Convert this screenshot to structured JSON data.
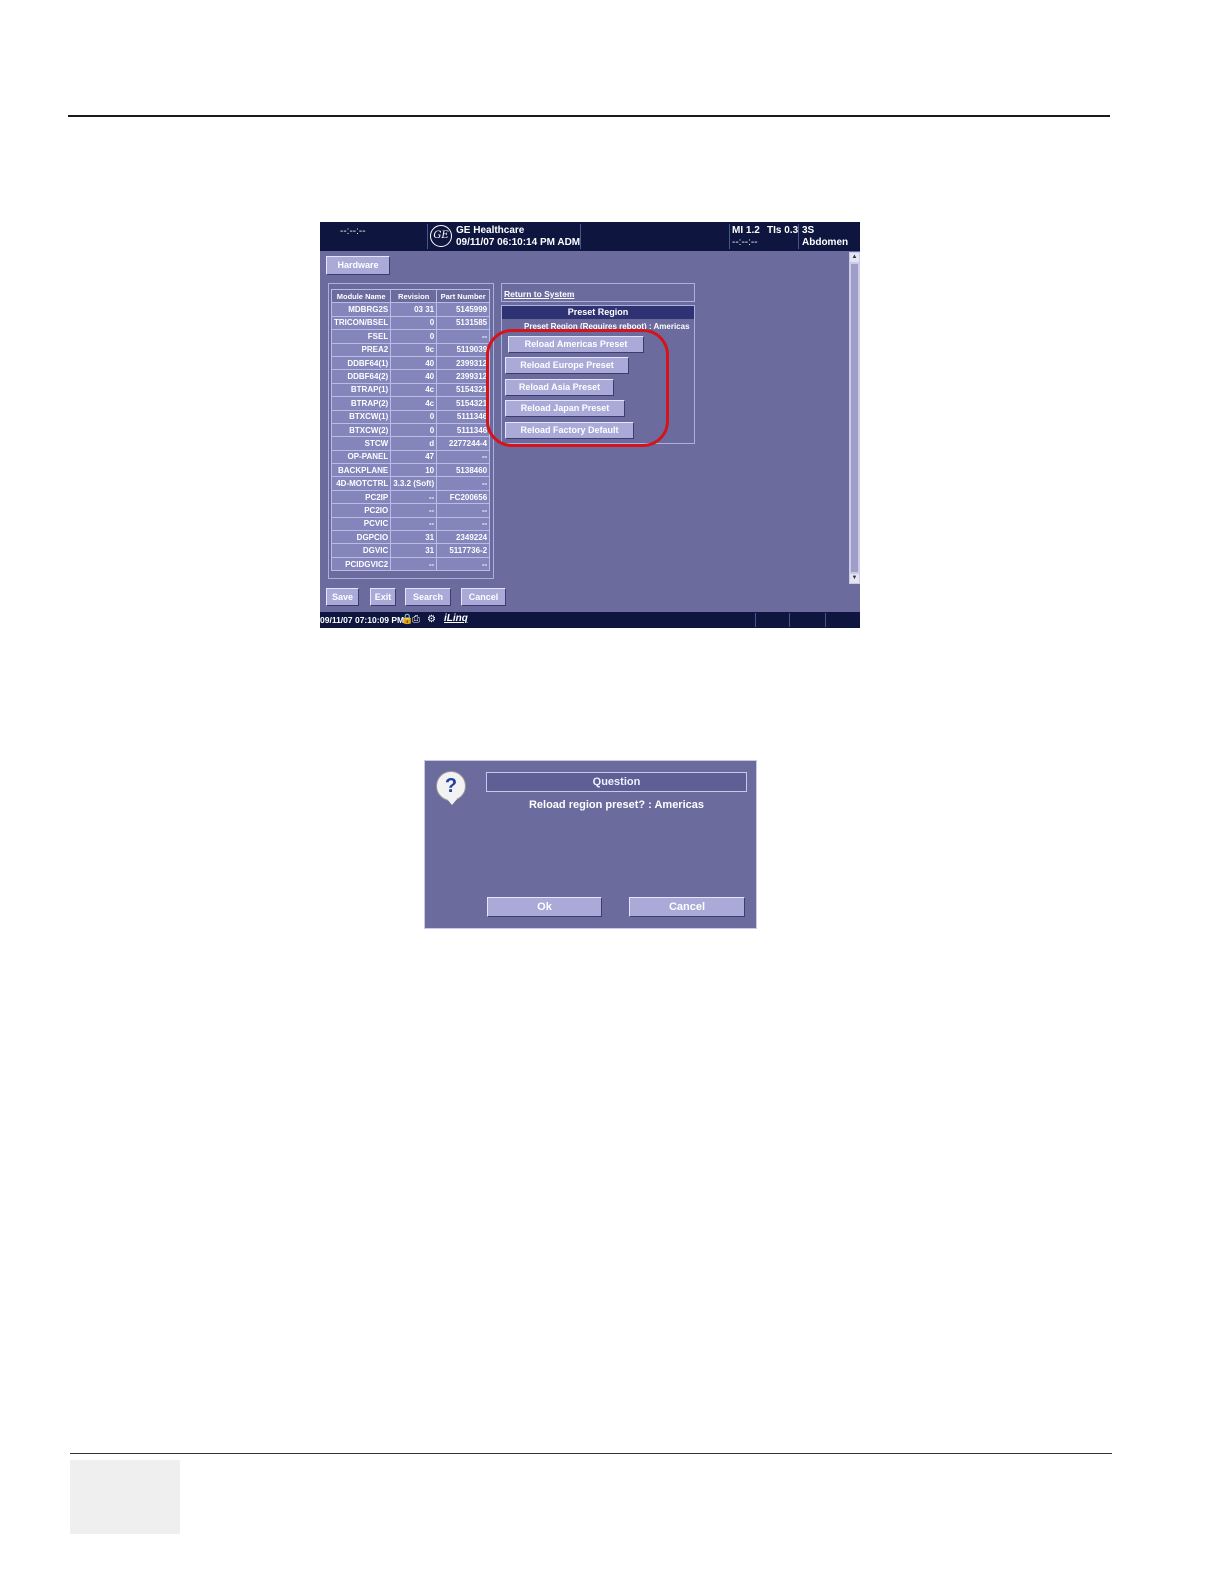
{
  "header": {
    "left_time": "--:--:--",
    "brand": "GE Healthcare",
    "datetime_user": "09/11/07 06:10:14 PM ADM",
    "mi": "MI 1.2",
    "tis": "TIs 0.3",
    "probe": "3S",
    "time_sub": "--:--:--",
    "exam": "Abdomen"
  },
  "tabs": {
    "hardware": "Hardware"
  },
  "hardware_table": {
    "columns": [
      "Module Name",
      "Revision",
      "Part Number"
    ],
    "rows": [
      [
        "MDBRG2S",
        "03 31",
        "5145999"
      ],
      [
        "TRICON/BSEL",
        "0",
        "5131585"
      ],
      [
        "FSEL",
        "0",
        "--"
      ],
      [
        "PREA2",
        "9c",
        "5119039"
      ],
      [
        "DDBF64(1)",
        "40",
        "2399312"
      ],
      [
        "DDBF64(2)",
        "40",
        "2399312"
      ],
      [
        "BTRAP(1)",
        "4c",
        "5154321"
      ],
      [
        "BTRAP(2)",
        "4c",
        "5154321"
      ],
      [
        "BTXCW(1)",
        "0",
        "5111346"
      ],
      [
        "BTXCW(2)",
        "0",
        "5111346"
      ],
      [
        "STCW",
        "d",
        "2277244-4"
      ],
      [
        "OP-PANEL",
        "47",
        "--"
      ],
      [
        "BACKPLANE",
        "10",
        "5138460"
      ],
      [
        "4D-MOTCTRL",
        "3.3.2 (Soft)",
        "--"
      ],
      [
        "PC2IP",
        "--",
        "FC200656"
      ],
      [
        "PC2IO",
        "--",
        "--"
      ],
      [
        "PCVIC",
        "--",
        "--"
      ],
      [
        "DGPCIO",
        "31",
        "2349224"
      ],
      [
        "DGVIC",
        "31",
        "5117736-2"
      ],
      [
        "PCIDGVIC2",
        "--",
        "--"
      ]
    ]
  },
  "return_link": "Return to System",
  "preset_panel": {
    "title": "Preset Region",
    "subtitle": "Preset Region (Requires reboot) : Americas",
    "buttons": [
      "Reload Americas Preset",
      "Reload Europe Preset",
      "Reload Asia Preset",
      "Reload Japan Preset",
      "Reload Factory Default"
    ]
  },
  "bottom_buttons": {
    "save": "Save",
    "exit": "Exit",
    "search": "Search",
    "cancel": "Cancel"
  },
  "status_bar": {
    "datetime": "09/11/07 07:10:09 PM",
    "ilinq": "iLinq"
  },
  "dialog": {
    "title": "Question",
    "message": "Reload region preset? : Americas",
    "ok": "Ok",
    "cancel": "Cancel",
    "icon": "question-icon"
  },
  "colors": {
    "panel_bg": "#6b6b9e",
    "header_bg": "#0e1640",
    "button_bg": "#a9aad8",
    "highlight_ring": "#d4141a"
  }
}
